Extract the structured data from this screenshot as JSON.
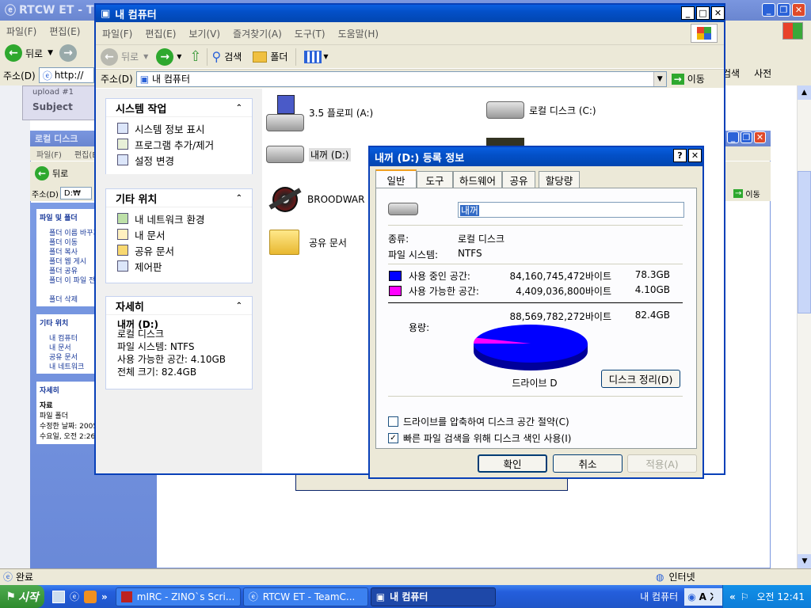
{
  "bg_ie": {
    "title": "RTCW ET - T",
    "menu": [
      "파일(F)",
      "편집(E)"
    ],
    "back_label": "뒤로",
    "address_label": "주소(D)",
    "address_value": "http://",
    "right_menu": [
      "검색",
      "사전"
    ],
    "upload_text": "upload #1",
    "subject_label": "Subject",
    "status": "완료",
    "zone": "인터넷"
  },
  "bg_explorer": {
    "title": "로컬 디스크",
    "menu": [
      "파일(F)",
      "편집(E)"
    ],
    "back_label": "뒤로",
    "address_label": "주소(D)",
    "address_value": "D:₩",
    "go_label": "이동",
    "tasks_header": "파일 및 폴더",
    "tasks": [
      "폴더 이름 바꾸기",
      "폴더 이동",
      "폴더 복사",
      "폴더 웹 게시",
      "폴더 공유",
      "폴더 이 파일 전자 메일로 보내기",
      "폴더 삭제"
    ],
    "other_header": "기타 위치",
    "other": [
      "내 컴퓨터",
      "내 문서",
      "공유 문서",
      "내 네트워크"
    ],
    "detail_header": "자세히",
    "detail_lines": [
      "자료",
      "파일 폴더",
      "수정한 날짜: 2005년 1월 1일",
      "수요일, 오전 2:26"
    ]
  },
  "mycomputer": {
    "title": "내 컴퓨터",
    "menu": [
      "파일(F)",
      "편집(E)",
      "보기(V)",
      "즐겨찾기(A)",
      "도구(T)",
      "도움말(H)"
    ],
    "toolbar": {
      "back": "뒤로",
      "search": "검색",
      "folders": "폴더"
    },
    "address_label": "주소(D)",
    "address_value": "내 컴퓨터",
    "go_label": "이동",
    "system_tasks": {
      "header": "시스템 작업",
      "items": [
        "시스템 정보 표시",
        "프로그램 추가/제거",
        "설정 변경"
      ]
    },
    "other_places": {
      "header": "기타 위치",
      "items": [
        "내 네트워크 환경",
        "내 문서",
        "공유 문서",
        "제어판"
      ]
    },
    "details": {
      "header": "자세히",
      "name": "내꺼 (D:)",
      "type": "로컬 디스크",
      "fs": "파일 시스템: NTFS",
      "free": "사용 가능한 공간: 4.10GB",
      "total": "전체 크기: 82.4GB"
    },
    "items": [
      "3.5 플로피 (A:)",
      "로컬 디스크 (C:)",
      "내꺼 (D:)",
      "BROODWAR (",
      "공유 문서"
    ]
  },
  "dialog": {
    "title": "내꺼 (D:) 등록 정보",
    "tabs": [
      "일반",
      "도구",
      "하드웨어",
      "공유",
      "할당량"
    ],
    "name_value": "내꺼",
    "type_label": "종류:",
    "type_value": "로컬 디스크",
    "fs_label": "파일 시스템:",
    "fs_value": "NTFS",
    "used_label": "사용 중인 공간:",
    "used_bytes": "84,160,745,472바이트",
    "used_gb": "78.3GB",
    "free_label": "사용 가능한 공간:",
    "free_bytes": "4,409,036,800바이트",
    "free_gb": "4.10GB",
    "cap_label": "용량:",
    "cap_bytes": "88,569,782,272바이트",
    "cap_gb": "82.4GB",
    "drive_label": "드라이브 D",
    "cleanup": "디스크 정리(D)",
    "compress": "드라이브를 압축하여 디스크 공간 절약(C)",
    "index": "빠른 파일 검색을 위해 디스크 색인 사용(I)",
    "ok": "확인",
    "cancel": "취소",
    "apply": "적용(A)",
    "used_fraction": 0.9502,
    "colors": {
      "used": "#0000FF",
      "free": "#FF00FF"
    }
  },
  "taskbar": {
    "start": "시작",
    "tasks": [
      "mIRC - ZINO`s Scri...",
      "RTCW ET - TeamC...",
      "내 컴퓨터"
    ],
    "tray_label": "내 컴퓨터",
    "clock": "오전 12:41"
  }
}
